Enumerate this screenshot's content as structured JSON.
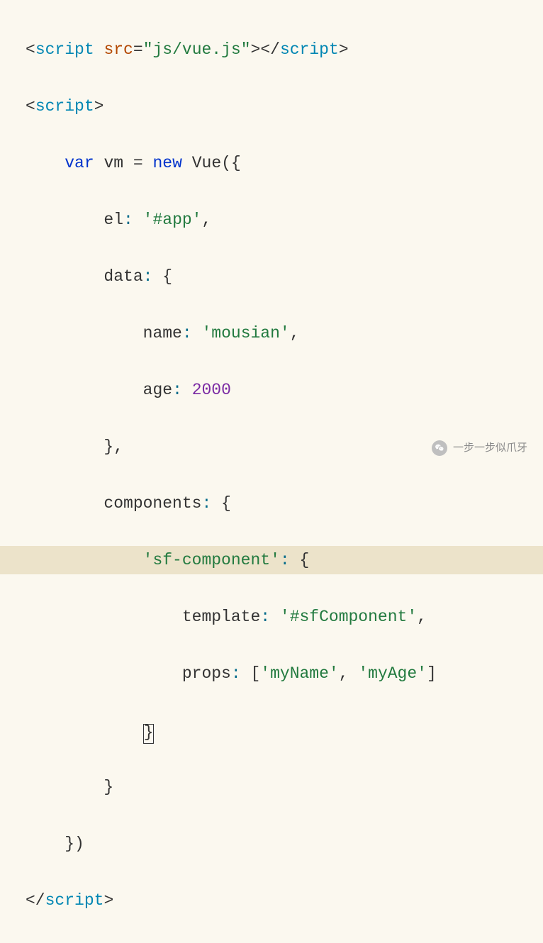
{
  "code": {
    "line1": {
      "open": "<",
      "tag": "script",
      "sp": " ",
      "attr": "src",
      "eq": "=",
      "val": "\"js/vue.js\"",
      "close": ">",
      "open2": "</",
      "tag2": "script",
      "close2": ">"
    },
    "line2": {
      "open": "<",
      "tag": "script",
      "close": ">"
    },
    "line3": {
      "indent": "    ",
      "kw1": "var",
      "sp1": " ",
      "vm": "vm",
      "sp2": " ",
      "eq": "=",
      "sp3": " ",
      "kw2": "new",
      "sp4": " ",
      "ctor": "Vue",
      "paren": "({"
    },
    "line4": {
      "indent": "        ",
      "prop": "el",
      "colon": ":",
      "sp": " ",
      "val": "'#app'",
      "comma": ","
    },
    "line5": {
      "indent": "        ",
      "prop": "data",
      "colon": ":",
      "sp": " ",
      "brace": "{"
    },
    "line6": {
      "indent": "            ",
      "prop": "name",
      "colon": ":",
      "sp": " ",
      "val": "'mousian'",
      "comma": ","
    },
    "line7": {
      "indent": "            ",
      "prop": "age",
      "colon": ":",
      "sp": " ",
      "num": "2000"
    },
    "line8": {
      "indent": "        ",
      "brace": "}",
      "comma": ","
    },
    "line9": {
      "indent": "        ",
      "prop": "components",
      "colon": ":",
      "sp": " ",
      "brace": "{"
    },
    "line10": {
      "indent": "            ",
      "key": "'sf-component'",
      "colon": ":",
      "sp": " ",
      "brace": "{"
    },
    "line11": {
      "indent": "                ",
      "prop": "template",
      "colon": ":",
      "sp": " ",
      "val": "'#sfComponent'",
      "comma": ","
    },
    "line12": {
      "indent": "                ",
      "prop": "props",
      "colon": ":",
      "sp": " ",
      "lb": "[",
      "v1": "'myName'",
      "c1": ",",
      "sp2": " ",
      "v2": "'myAge'",
      "rb": "]"
    },
    "line13": {
      "indent": "            ",
      "brace": "}"
    },
    "line14": {
      "indent": "        ",
      "brace": "}"
    },
    "line15": {
      "indent": "    ",
      "close": "})"
    },
    "line16": {
      "open": "</",
      "tag": "script",
      "close": ">"
    }
  },
  "watermark": {
    "text": "一步一步似爪牙"
  }
}
